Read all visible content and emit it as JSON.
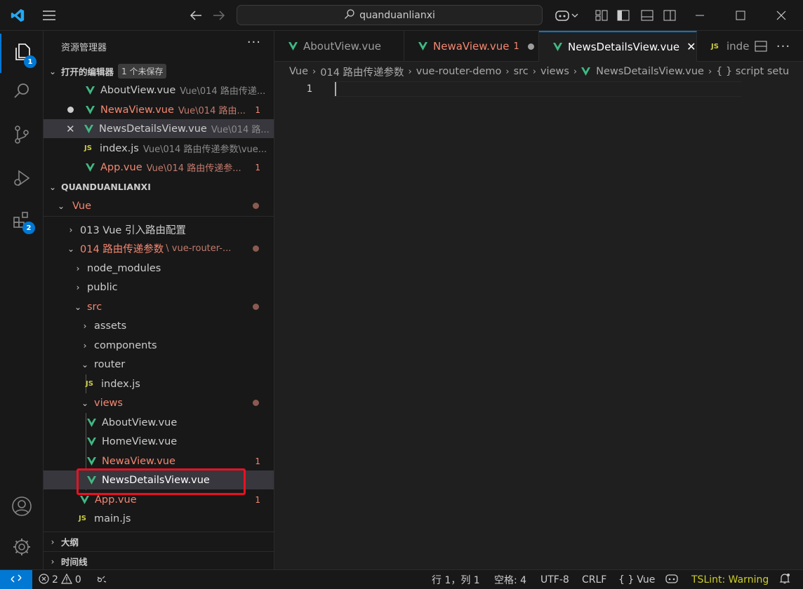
{
  "titlebar": {
    "search_text": "quanduanlianxi"
  },
  "activity": {
    "explorer_badge": "1",
    "extensions_badge": "2"
  },
  "sidebar": {
    "title": "资源管理器",
    "more": "···",
    "open_editors": {
      "header": "打开的编辑器",
      "unsaved": "1 个未保存",
      "items": [
        {
          "name": "AboutView.vue",
          "desc": "Vue\\014 路由传递..."
        },
        {
          "name": "NewaView.vue",
          "desc": "Vue\\014 路由...",
          "count": "1"
        },
        {
          "name": "NewsDetailsView.vue",
          "desc": "Vue\\014 路..."
        },
        {
          "name": "index.js",
          "desc": "Vue\\014 路由传递参数\\vue..."
        },
        {
          "name": "App.vue",
          "desc": "Vue\\014 路由传递参...",
          "count": "1"
        }
      ]
    },
    "workspace": {
      "header": "QUANDUANLIANXI",
      "tree": [
        {
          "label": "Vue"
        },
        {
          "label": "013 Vue 引入路由配置"
        },
        {
          "label": "014 路由传递参数",
          "desc": "\\ vue-router-..."
        },
        {
          "label": "node_modules"
        },
        {
          "label": "public"
        },
        {
          "label": "src"
        },
        {
          "label": "assets"
        },
        {
          "label": "components"
        },
        {
          "label": "router"
        },
        {
          "label": "index.js"
        },
        {
          "label": "views"
        },
        {
          "label": "AboutView.vue"
        },
        {
          "label": "HomeView.vue"
        },
        {
          "label": "NewaView.vue",
          "count": "1"
        },
        {
          "label": "NewsDetailsView.vue"
        },
        {
          "label": "App.vue",
          "count": "1"
        },
        {
          "label": "main.js"
        }
      ]
    },
    "outline": "大纲",
    "timeline": "时间线"
  },
  "tabs": [
    {
      "label": "AboutView.vue"
    },
    {
      "label": "NewaView.vue",
      "count": "1"
    },
    {
      "label": "NewsDetailsView.vue"
    },
    {
      "label": "inde"
    }
  ],
  "breadcrumb": [
    "Vue",
    "014 路由传递参数",
    "vue-router-demo",
    "src",
    "views",
    "NewsDetailsView.vue",
    "{ } script setu"
  ],
  "editor": {
    "line": "1"
  },
  "statusbar": {
    "errors": "2",
    "warnings": "0",
    "position": "行 1，列 1",
    "spaces": "空格: 4",
    "encoding": "UTF-8",
    "eol": "CRLF",
    "language": "Vue",
    "tslint": "TSLint: Warning"
  },
  "colors": {
    "accent": "#0078d4",
    "error": "#f48771",
    "vue_green": "#41b883",
    "js_yellow": "#cbcb41",
    "highlight": "#e81123"
  }
}
